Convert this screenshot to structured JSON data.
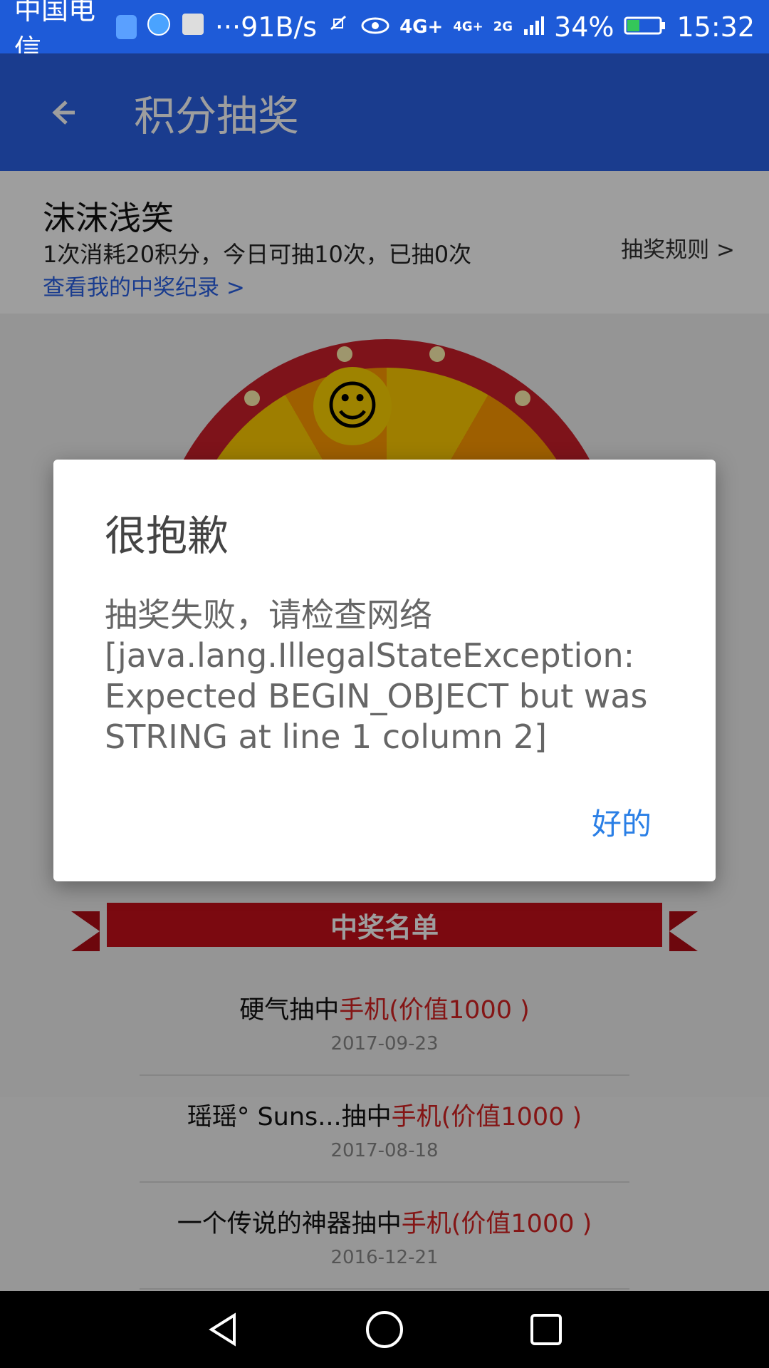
{
  "status_bar": {
    "carrier": "中国电信",
    "more": "···",
    "net_speed": "91B/s",
    "signal_label_1": "4G+",
    "signal_label_2": "4G+",
    "signal_label_3": "2G",
    "battery_percent": "34%",
    "time": "15:32",
    "icons": [
      "app-badge-icon",
      "globe-icon",
      "avatar-icon",
      "mute-icon",
      "eye-icon",
      "signal-icon",
      "battery-icon"
    ]
  },
  "app_bar": {
    "title": "积分抽奖"
  },
  "user": {
    "name": "沫沫浅笑",
    "summary": "1次消耗20积分，今日可抽10次，已抽0次",
    "records_link": "查看我的中奖纪录 >",
    "rules_link": "抽奖规则 >"
  },
  "dialog": {
    "title": "很抱歉",
    "message": "抽奖失败，请检查网络\n[java.lang.IllegalStateException: Expected BEGIN_OBJECT but was STRING at line 1 column 2]",
    "ok_label": "好的"
  },
  "winners": {
    "banner": "中奖名单",
    "items": [
      {
        "user_prefix": "硬气抽中",
        "prize": "手机(价值1000 )",
        "date": "2017-09-23"
      },
      {
        "user_prefix": "瑶瑶° Suns...抽中",
        "prize": "手机(价值1000 )",
        "date": "2017-08-18"
      },
      {
        "user_prefix": "一个传说的神器抽中",
        "prize": "手机(价值1000 )",
        "date": "2016-12-21"
      }
    ]
  },
  "colors": {
    "accent": "#2a62e6",
    "prize_red": "#d62222",
    "dialog_button": "#2a7fe6"
  }
}
